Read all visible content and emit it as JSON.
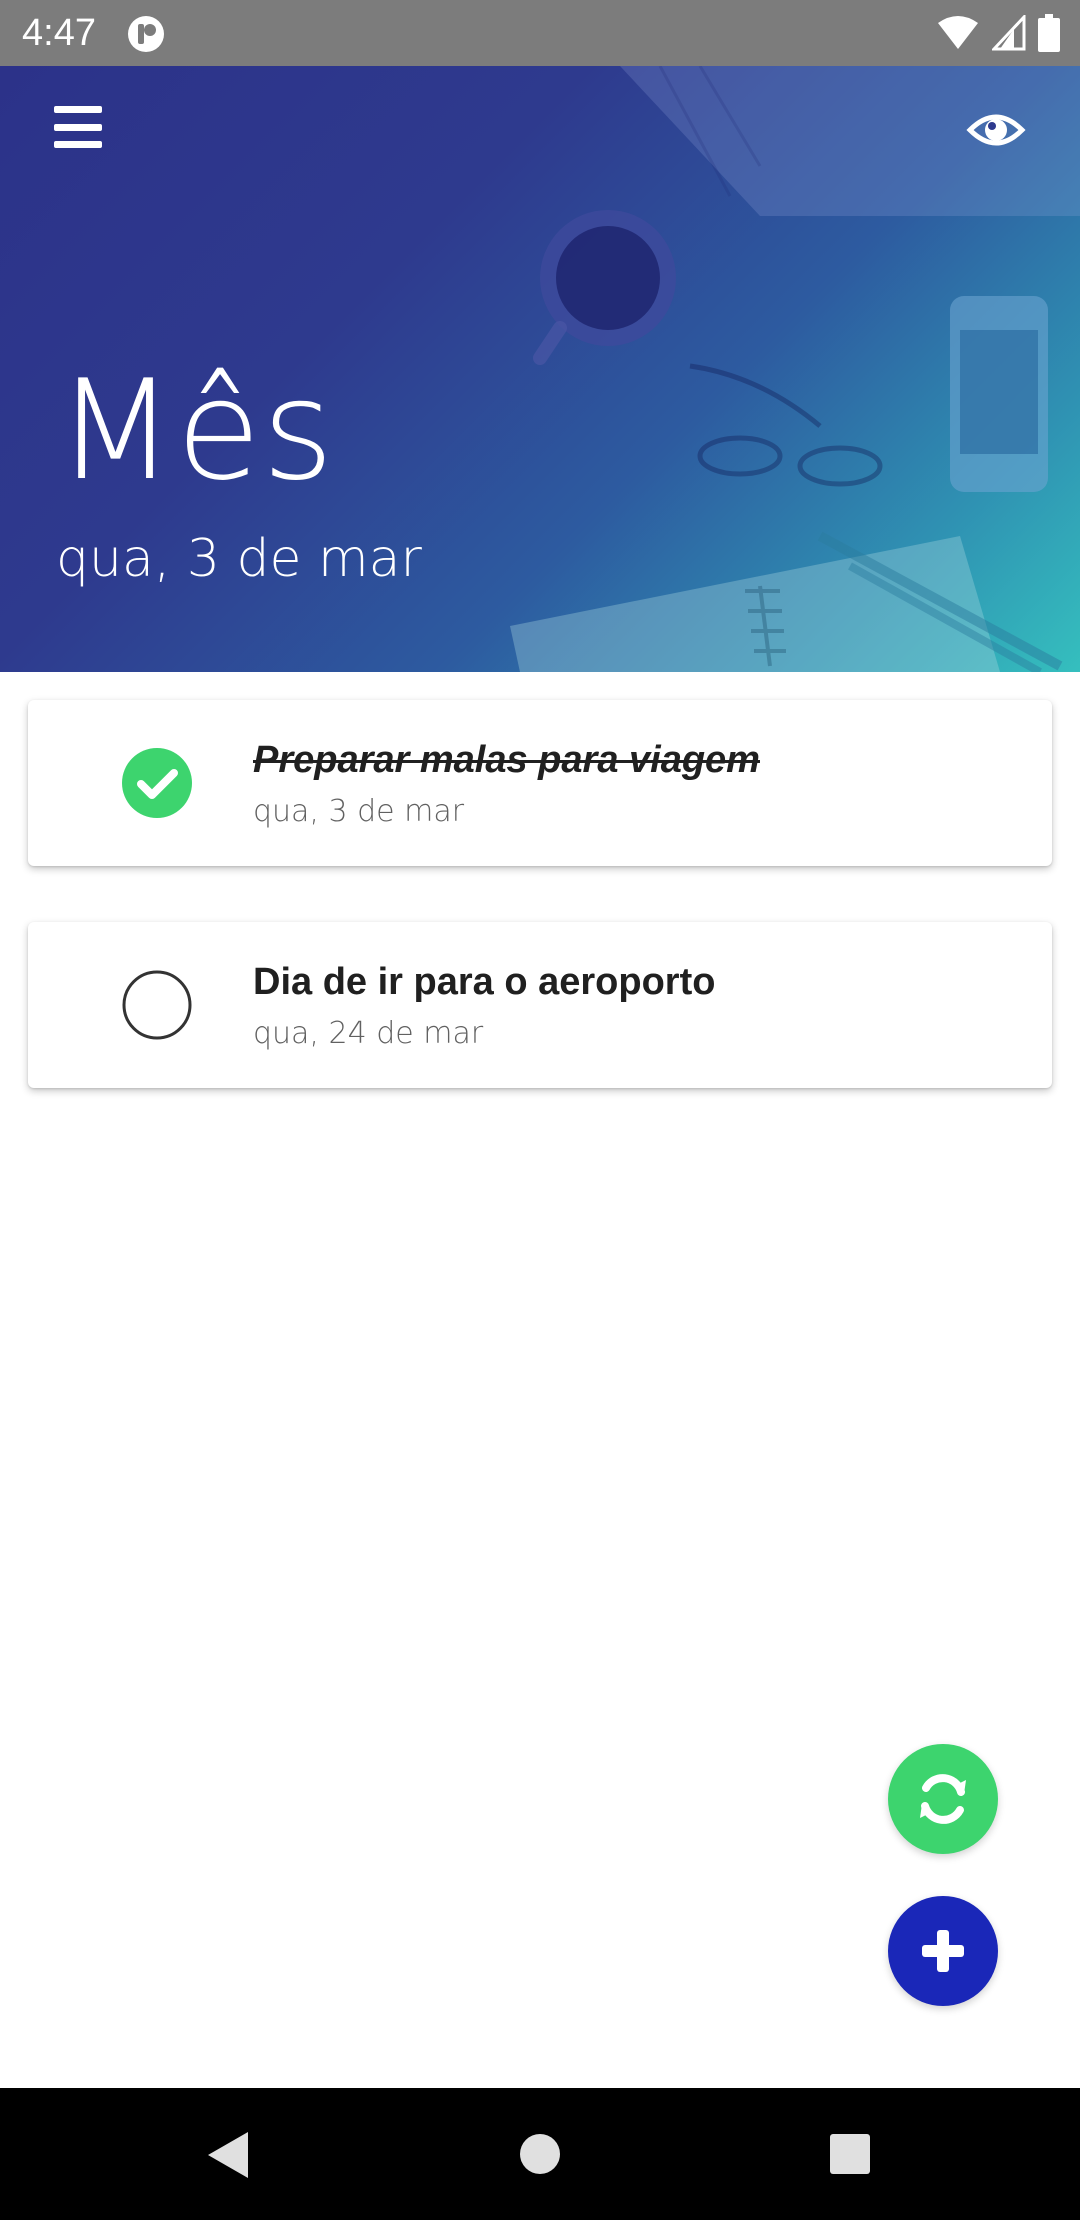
{
  "status_bar": {
    "time": "4:47",
    "icons": [
      "app-notification-icon",
      "wifi-icon",
      "cellular-signal-icon",
      "battery-icon"
    ]
  },
  "header": {
    "title": "Mês",
    "subtitle": "qua, 3 de mar",
    "menu_icon": "hamburger-menu-icon",
    "view_icon": "eye-icon"
  },
  "tasks": [
    {
      "title": "Preparar malas para viagem",
      "date": "qua, 3 de mar",
      "completed": true
    },
    {
      "title": "Dia de ir para o aeroporto",
      "date": "qua, 24 de mar",
      "completed": false
    }
  ],
  "fabs": {
    "sync_icon": "sync-icon",
    "add_icon": "plus-icon"
  },
  "nav_bar": {
    "icons": [
      "back-icon",
      "home-icon",
      "recents-icon"
    ]
  },
  "colors": {
    "header_gradient_start": "#2c3289",
    "header_gradient_end": "#35bfbe",
    "check_done": "#3dd46e",
    "fab_sync": "#3dd46e",
    "fab_add": "#1a27b8",
    "status_bar": "#7c7c7c",
    "nav_bar": "#000000"
  }
}
